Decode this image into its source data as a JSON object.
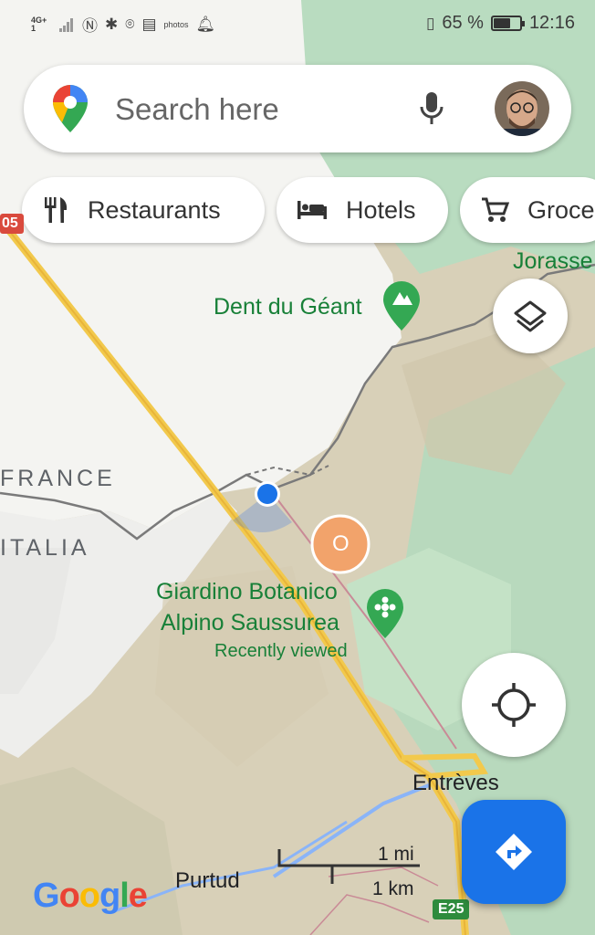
{
  "status_bar": {
    "network": "4G+",
    "network_sub": "1",
    "battery": "65 %",
    "battery_level": 0.65,
    "time": "12:16",
    "icons": [
      "signal-icon",
      "nfc-icon",
      "bluetooth-icon",
      "location-icon",
      "news-icon",
      "amazon-photos-icon",
      "notification-bell-icon",
      "vibrate-icon",
      "battery-icon"
    ],
    "photos_label": "photos"
  },
  "search": {
    "placeholder": "Search here"
  },
  "chips": [
    {
      "label": "Restaurants",
      "icon": "fork-knife-icon"
    },
    {
      "label": "Hotels",
      "icon": "bed-icon"
    },
    {
      "label": "Groce",
      "icon": "cart-icon"
    }
  ],
  "map": {
    "places": [
      {
        "name": "Dent du Géant",
        "icon": "mountain-icon"
      },
      {
        "name": "Jorasse",
        "icon": ""
      },
      {
        "name": "Giardino Botanico",
        "name2": "Alpino Saussurea",
        "sub": "Recently viewed",
        "icon": "flower-icon"
      }
    ],
    "countries": [
      "FRANCE",
      "ITALIA"
    ],
    "towns": [
      "Entrèves",
      "Purtud"
    ],
    "cluster_label": "O",
    "road_shields": [
      "E25",
      "05"
    ]
  },
  "scale": {
    "imperial": "1 mi",
    "metric": "1 km"
  },
  "brand": {
    "logo": "Google",
    "colors": {
      "blue": "#4285F4",
      "red": "#EA4335",
      "yellow": "#FBBC05",
      "green": "#34A853",
      "accent": "#1a73e8"
    }
  }
}
